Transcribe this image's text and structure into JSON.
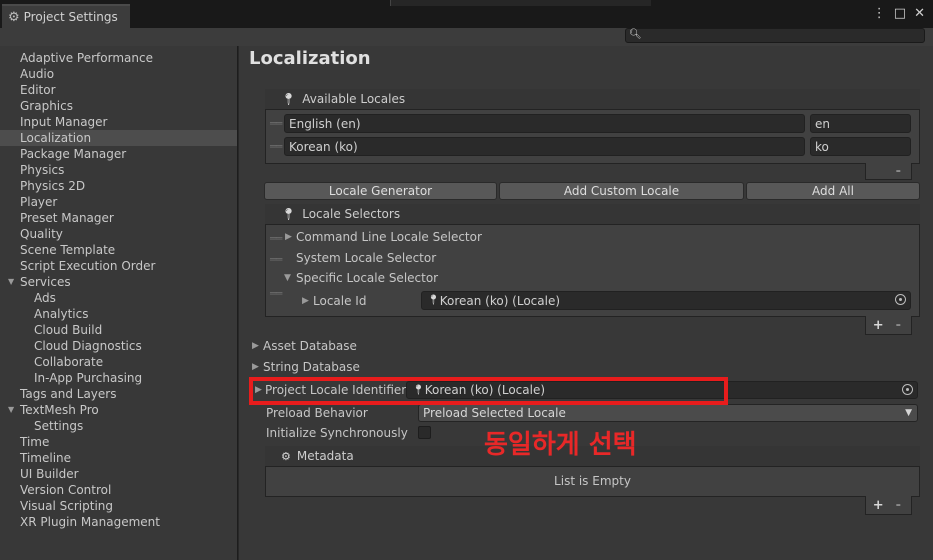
{
  "window": {
    "tab_title": "Project Settings",
    "bg_tab_title": "Player",
    "more_glyph": "⋮",
    "maximize_glyph": "□",
    "close_glyph": "✕"
  },
  "search": {
    "placeholder": "",
    "icon": "search-icon"
  },
  "sidebar": {
    "items": [
      {
        "label": "Adaptive Performance"
      },
      {
        "label": "Audio"
      },
      {
        "label": "Editor"
      },
      {
        "label": "Graphics"
      },
      {
        "label": "Input Manager"
      },
      {
        "label": "Localization",
        "active": true
      },
      {
        "label": "Package Manager"
      },
      {
        "label": "Physics"
      },
      {
        "label": "Physics 2D"
      },
      {
        "label": "Player"
      },
      {
        "label": "Preset Manager"
      },
      {
        "label": "Quality"
      },
      {
        "label": "Scene Template"
      },
      {
        "label": "Script Execution Order"
      },
      {
        "label": "Services",
        "expanded": true
      },
      {
        "label": "Ads",
        "child": true
      },
      {
        "label": "Analytics",
        "child": true
      },
      {
        "label": "Cloud Build",
        "child": true
      },
      {
        "label": "Cloud Diagnostics",
        "child": true
      },
      {
        "label": "Collaborate",
        "child": true
      },
      {
        "label": "In-App Purchasing",
        "child": true
      },
      {
        "label": "Tags and Layers"
      },
      {
        "label": "TextMesh Pro",
        "expanded": true
      },
      {
        "label": "Settings",
        "child": true
      },
      {
        "label": "Time"
      },
      {
        "label": "Timeline"
      },
      {
        "label": "UI Builder"
      },
      {
        "label": "Version Control"
      },
      {
        "label": "Visual Scripting"
      },
      {
        "label": "XR Plugin Management"
      }
    ]
  },
  "main": {
    "title": "Localization",
    "available_locales": {
      "header": "Available Locales",
      "rows": [
        {
          "name": "English (en)",
          "code": "en"
        },
        {
          "name": "Korean (ko)",
          "code": "ko"
        }
      ],
      "minus": "-"
    },
    "buttons": {
      "locale_generator": "Locale Generator",
      "add_custom_locale": "Add Custom Locale",
      "add_all": "Add All"
    },
    "locale_selectors": {
      "header": "Locale Selectors",
      "items": [
        "Command Line Locale Selector",
        "System Locale Selector",
        "Specific Locale Selector"
      ],
      "locale_id_label": "Locale Id",
      "locale_id_value": "Korean (ko) (Locale)",
      "plus": "+",
      "minus": "-"
    },
    "asset_database": "Asset Database",
    "string_database": "String Database",
    "project_locale_identifier": {
      "label": "Project Locale Identifier",
      "value": "Korean (ko) (Locale)"
    },
    "preload_behavior": {
      "label": "Preload Behavior",
      "value": "Preload Selected Locale"
    },
    "initialize_sync": {
      "label": "Initialize Synchronously",
      "checked": false
    },
    "metadata": {
      "header": "Metadata",
      "empty_text": "List is Empty",
      "plus": "+",
      "minus": "-"
    }
  },
  "annotation": {
    "text": "동일하게 선택",
    "color": "#e82828"
  }
}
